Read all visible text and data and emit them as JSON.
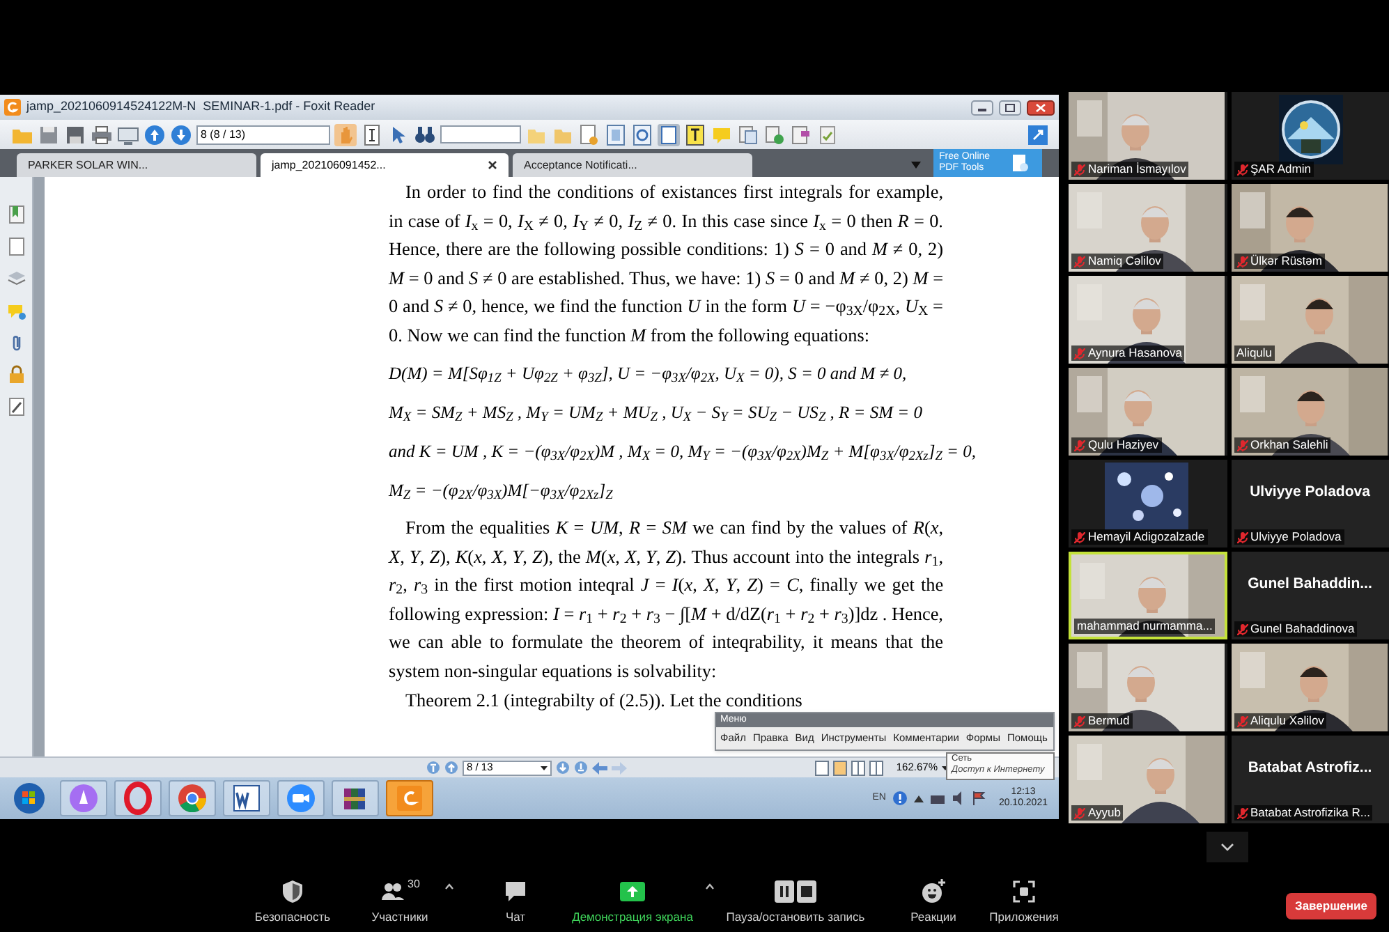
{
  "shared_screen": {
    "window": {
      "title": "jamp_2021060914524122M-N  SEMINAR-1.pdf - Foxit Reader"
    },
    "toolbar": {
      "page_field": "8 (8 / 13)"
    },
    "tabs": [
      {
        "label": "PARKER SOLAR WIN...",
        "selected": false,
        "closable": false
      },
      {
        "label": "jamp_202106091452...",
        "selected": true,
        "closable": true
      },
      {
        "label": "Acceptance Notificati...",
        "selected": false,
        "closable": false
      }
    ],
    "tools_button": "Free Online PDF Tools",
    "document": [
      {
        "kind": "paragraph",
        "text": "In order to find the conditions of existances first integrals for example, in case of *I*$_{x}$ = 0, *I*$_{X}$ ≠ 0, *I*$_{Y}$ ≠ 0, *I*$_{Z}$ ≠ 0. In this case since *I*$_{x}$ = 0 then *R* = 0. Hence, there are the following possible conditions: 1) *S* = 0 and *M* ≠ 0, 2) *M* = 0 and *S* ≠ 0 are established. Thus, we have: 1) *S* = 0 and *M* ≠ 0, 2) *M* = 0 and *S* ≠ 0, hence, we find the function *U* in the form *U* = −φ$_{3X}$/φ$_{2X}$, *U*$_{X}$ = 0. Now we can find the function *M* from the following equations:"
      },
      {
        "kind": "equation",
        "text": "D(M) = M[Sφ$_{1Z}$ + Uφ$_{2Z}$ + φ$_{3Z}$],  U = −φ$_{3X}$/φ$_{2X}$,  U$_{X}$ = 0),  S = 0  and  M ≠ 0,"
      },
      {
        "kind": "equation",
        "text": "M$_{X}$ = SM$_{Z}$ + MS$_{Z}$ ,  M$_{Y}$ = UM$_{Z}$ + MU$_{Z}$ ,  U$_{X}$ − S$_{Y}$ = SU$_{Z}$ − US$_{Z}$ ,  R = SM = 0"
      },
      {
        "kind": "equation",
        "text": "and  K = UM ,  K = −(φ$_{3X}$/φ$_{2X}$)M ,  M$_{X}$ = 0,  M$_{Y}$ = −(φ$_{3X}$/φ$_{2X}$)M$_{Z}$ + M[φ$_{3X}$/φ$_{2Xz}$]$_{Z}$ = 0,"
      },
      {
        "kind": "equation",
        "text": "M$_{Z}$ = −(φ$_{2X}$/φ$_{3X}$)M[−φ$_{3X}$/φ$_{2Xz}$]$_{Z}$"
      },
      {
        "kind": "paragraph",
        "text": "From the equalities *K* = *UM*, *R* = *SM* we can find by the values of *R*(*x*, *X*, *Y*, *Z*), *K*(*x*, *X*, *Y*, *Z*), the *M*(*x*, *X*, *Y*, *Z*). Thus account into the integrals *r*$_{1}$, *r*$_{2}$, *r*$_{3}$ in the first motion inteqral *J* = *I*(*x*, *X*, *Y*, *Z*) = *C*, finally we get the following expression: *I* = *r*$_{1}$ + *r*$_{2}$ + *r*$_{3}$ − ∫[*M* + d/dZ(*r*$_{1}$ + *r*$_{2}$ + *r*$_{3}$)]dz . Hence, we can able to formulate the theorem of inteqrability, it means that the system non-singular equations is solvability:"
      },
      {
        "kind": "paragraph",
        "text": "Theorem 2.1 (integrabilty of (2.5)). Let the conditions"
      }
    ],
    "menu": {
      "title": "Меню",
      "items": [
        "Файл",
        "Правка",
        "Вид",
        "Инструменты",
        "Комментарии",
        "Формы",
        "Помощь"
      ]
    },
    "page_nav": {
      "page_field": "8 / 13",
      "zoom": "162.67%"
    },
    "tooltip": {
      "title": "Сеть",
      "text": "Доступ к Интернету"
    },
    "taskbar": {
      "apps": [
        {
          "kind": "start",
          "selected": false
        },
        {
          "kind": "assistant",
          "selected": false
        },
        {
          "kind": "opera",
          "selected": false
        },
        {
          "kind": "chrome",
          "selected": false
        },
        {
          "kind": "word",
          "selected": false
        },
        {
          "kind": "zoom",
          "selected": false
        },
        {
          "kind": "archiver",
          "selected": false
        },
        {
          "kind": "foxit",
          "selected": true
        }
      ],
      "language": "EN",
      "time": "12:13",
      "date": "20.10.2021"
    }
  },
  "participants": [
    {
      "name": "Nariman İsmayılov",
      "muted": true,
      "kind": "camera",
      "speaking": false
    },
    {
      "name": "ŞAR Admin",
      "muted": true,
      "speaking": false
    },
    {
      "name": "Namiq Cəlilov",
      "muted": true,
      "kind": "camera",
      "speaking": false
    },
    {
      "name": "Ülkər Rüstəm",
      "muted": true,
      "kind": "camera",
      "speaking": false
    },
    {
      "name": "Aynura Hasanova",
      "muted": true,
      "kind": "camera",
      "speaking": false
    },
    {
      "name": "Aliqulu",
      "muted": false,
      "kind": "camera",
      "speaking": false
    },
    {
      "name": "Qulu Haziyev",
      "muted": true,
      "kind": "camera",
      "speaking": false
    },
    {
      "name": "Orkhan Salehli",
      "muted": true,
      "kind": "camera",
      "speaking": false
    },
    {
      "name": "Hemayil Adigozalzade",
      "muted": true,
      "speaking": false
    },
    {
      "name": "Ulviyye Poladova",
      "muted": true,
      "kind": "name",
      "display_name": "Ulviyye Poladova",
      "speaking": false
    },
    {
      "name": "mahammad nurmamma...",
      "muted": false,
      "kind": "camera",
      "speaking": true
    },
    {
      "name": "Gunel Bahaddinova",
      "muted": true,
      "kind": "name",
      "display_name": "Gunel  Bahaddin...",
      "speaking": false
    },
    {
      "name": "Bermud",
      "muted": true,
      "kind": "camera",
      "speaking": false
    },
    {
      "name": "Aliqulu Xəlilov",
      "muted": true,
      "kind": "camera",
      "speaking": false
    },
    {
      "name": "Ayyub",
      "muted": true,
      "kind": "camera",
      "speaking": false
    },
    {
      "name": "Batabat Astrofizika R...",
      "muted": true,
      "kind": "name",
      "display_name": "Batabat  Astrofiz...",
      "speaking": false
    }
  ],
  "controls": [
    {
      "kind": "security",
      "label": "Безопасность"
    },
    {
      "kind": "participants",
      "label": "Участники",
      "count": "30",
      "menu": true
    },
    {
      "kind": "chat",
      "label": "Чат"
    },
    {
      "kind": "share",
      "label": "Демонстрация экрана",
      "menu": true,
      "active": true
    },
    {
      "kind": "record",
      "label": "Пауза/остановить запись"
    },
    {
      "kind": "reactions",
      "label": "Реакции"
    },
    {
      "kind": "apps",
      "label": "Приложения"
    }
  ],
  "end_button": "Завершение"
}
